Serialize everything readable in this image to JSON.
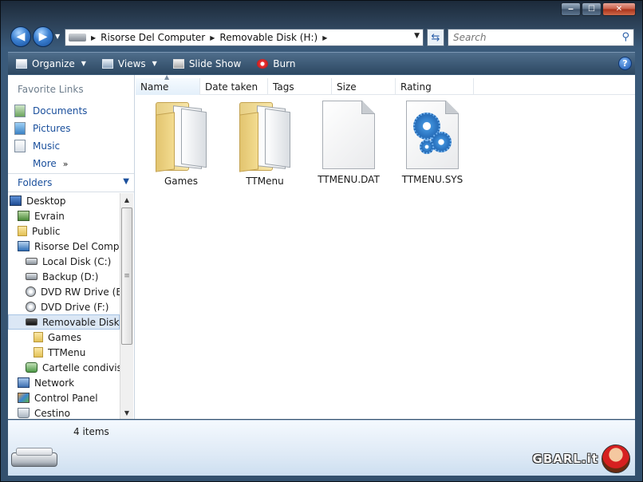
{
  "window": {
    "caption": {
      "minimize": "‒",
      "maximize": "☐",
      "close": "✕"
    }
  },
  "address": {
    "crumbs": [
      "Risorse Del Computer",
      "Removable Disk (H:)"
    ],
    "search_placeholder": "Search"
  },
  "toolbar": {
    "items": [
      {
        "label": "Organize",
        "has_dropdown": true,
        "icon": "organize-icon"
      },
      {
        "label": "Views",
        "has_dropdown": true,
        "icon": "views-icon"
      },
      {
        "label": "Slide Show",
        "has_dropdown": false,
        "icon": "slideshow-icon"
      },
      {
        "label": "Burn",
        "has_dropdown": false,
        "icon": "burn-icon"
      }
    ],
    "help": "?"
  },
  "favorites": {
    "title": "Favorite Links",
    "items": [
      {
        "label": "Documents",
        "icon": "documents-icon"
      },
      {
        "label": "Pictures",
        "icon": "pictures-icon"
      },
      {
        "label": "Music",
        "icon": "music-icon"
      }
    ],
    "more": "More",
    "more_chevron": "»"
  },
  "folders": {
    "title": "Folders",
    "tree": [
      {
        "label": "Desktop",
        "icon": "desktop-icon",
        "level": 0
      },
      {
        "label": "Evrain",
        "icon": "user-folder-icon",
        "level": 1
      },
      {
        "label": "Public",
        "icon": "folder-icon",
        "level": 1
      },
      {
        "label": "Risorse Del Computer",
        "icon": "computer-icon",
        "level": 1
      },
      {
        "label": "Local Disk (C:)",
        "icon": "drive-icon",
        "level": 2
      },
      {
        "label": "Backup (D:)",
        "icon": "drive-icon",
        "level": 2
      },
      {
        "label": "DVD RW Drive (E:)",
        "icon": "dvd-icon",
        "level": 2
      },
      {
        "label": "DVD Drive (F:)",
        "icon": "dvd-icon",
        "level": 2
      },
      {
        "label": "Removable Disk (H:)",
        "icon": "removable-drive-icon",
        "level": 2,
        "selected": true
      },
      {
        "label": "Games",
        "icon": "folder-icon",
        "level": 3
      },
      {
        "label": "TTMenu",
        "icon": "folder-icon",
        "level": 3
      },
      {
        "label": "Cartelle condivise",
        "icon": "shared-folders-icon",
        "level": 2
      },
      {
        "label": "Network",
        "icon": "network-icon",
        "level": 1
      },
      {
        "label": "Control Panel",
        "icon": "control-panel-icon",
        "level": 1
      },
      {
        "label": "Cestino",
        "icon": "recycle-bin-icon",
        "level": 1
      }
    ]
  },
  "columns": [
    "Name",
    "Date taken",
    "Tags",
    "Size",
    "Rating"
  ],
  "files": [
    {
      "label": "Games",
      "type": "folder"
    },
    {
      "label": "TTMenu",
      "type": "folder"
    },
    {
      "label": "TTMENU.DAT",
      "type": "document"
    },
    {
      "label": "TTMENU.SYS",
      "type": "system-file"
    }
  ],
  "details": {
    "item_count": "4 items"
  },
  "watermark": {
    "text": "GBARL.it"
  }
}
